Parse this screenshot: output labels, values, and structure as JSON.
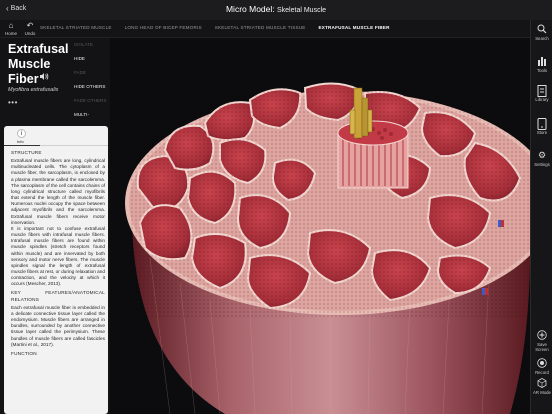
{
  "window": {
    "back_label": "Back",
    "title": "Micro Model:",
    "subtitle": "Skeletal Muscle"
  },
  "tools": {
    "home_label": "Home",
    "undo_label": "Undo"
  },
  "breadcrumbs": [
    {
      "label": "SKELETAL STRIATED MUSCLE",
      "active": false
    },
    {
      "label": "LONG HEAD OF BICEP FEMORIS",
      "active": false
    },
    {
      "label": "SKELETAL STRIATED MUSCLE TISSUE",
      "active": false
    },
    {
      "label": "EXTRAFUSAL MUSCLE FIBER",
      "active": true
    }
  ],
  "structure": {
    "name": "Extrafusal Muscle Fiber",
    "latin_name": "Myofibra extrafusalis",
    "more": "•••"
  },
  "actions": [
    {
      "label": "ISOLATE",
      "enabled": false
    },
    {
      "label": "HIDE",
      "enabled": true
    },
    {
      "label": "FADE",
      "enabled": false
    },
    {
      "label": "HIDE OTHERS",
      "enabled": true
    },
    {
      "label": "FADE OTHERS",
      "enabled": false
    },
    {
      "label": "MULTI-SELECTION",
      "enabled": true
    }
  ],
  "info": {
    "tab_label": "Info",
    "section1_title": "STRUCTURE",
    "section1_p1": "Extrafusal muscle fibers are long, cylindrical multinucleated cells. The cytoplasm of a muscle fiber, the sarcoplasm, is enclosed by a plasma membrane called the sarcolemma. The sarcoplasm of the cell contains chains of long cylindrical structure called myofibrils that extend the length of the muscle fiber. Numerous nuclei occupy the space between adjacent myofibrils and the sarcolemma. Extrafusal muscle fibers receive motor innervation.",
    "section1_p2": "It is important not to confuse extrafusal muscle fibers with intrafusal muscle fibers. Intrafusal muscle fibers are found within muscle spindles (stretch receptors found within muscle) and are innervated by both sensory and motor nerve fibers. The muscle spindles signal the length of extrafusal muscle fibers at rest, or during relaxation and contraction, and the velocity at which it occurs (Mescher, 2013).",
    "section2_title": "KEY FEATURES/ANATOMICAL RELATIONS",
    "section2_p1": "Each extrafusal muscle fiber is embedded in a delicate connective tissue layer called the endomysium. Muscle fibers are arranged in bundles, surrounded by another connective tissue layer called the perimysium. These bundles of muscle fibers are called fascicles (Martini et al., 2017).",
    "section3_title": "FUNCTION"
  },
  "rail": {
    "search": "Search",
    "tools": "Tools",
    "library": "Library",
    "store": "Store",
    "settings": "Settings",
    "save_screen": "Save Screen",
    "record": "Record",
    "ar_mode": "AR Mode"
  },
  "colors": {
    "muscle": "#b83a44",
    "muscle_dark": "#7a1f28",
    "perimysium": "#f0cfc8",
    "panel_bg": "#131315",
    "info_bg": "#f2f2f2"
  }
}
